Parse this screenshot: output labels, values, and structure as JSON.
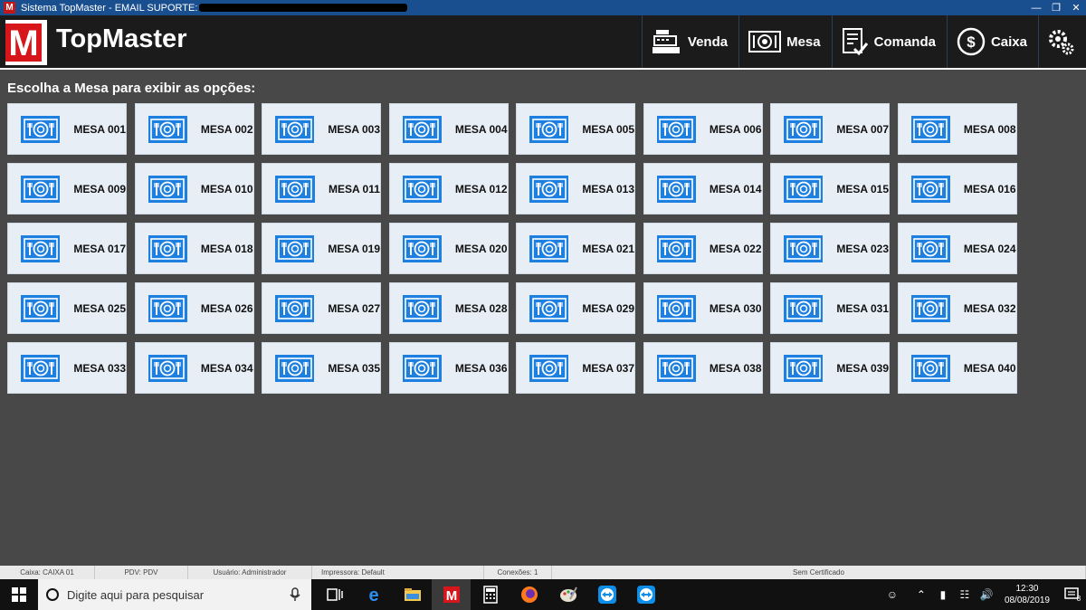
{
  "titlebar": {
    "title": "Sistema TopMaster - EMAIL SUPORTE:"
  },
  "header": {
    "brand": "TopMaster",
    "logo_letter": "M",
    "nav": [
      {
        "label": "Venda",
        "icon": "cash-register-icon"
      },
      {
        "label": "Mesa",
        "icon": "plate-icon"
      },
      {
        "label": "Comanda",
        "icon": "checklist-icon"
      },
      {
        "label": "Caixa",
        "icon": "dollar-coin-icon"
      },
      {
        "label": "",
        "icon": "gears-icon"
      }
    ]
  },
  "main": {
    "prompt": "Escolha a Mesa para exibir as opções:",
    "tables": [
      "MESA 001",
      "MESA 002",
      "MESA 003",
      "MESA 004",
      "MESA 005",
      "MESA 006",
      "MESA 007",
      "MESA 008",
      "MESA 009",
      "MESA 010",
      "MESA 011",
      "MESA 012",
      "MESA 013",
      "MESA 014",
      "MESA 015",
      "MESA 016",
      "MESA 017",
      "MESA 018",
      "MESA 019",
      "MESA 020",
      "MESA 021",
      "MESA 022",
      "MESA 023",
      "MESA 024",
      "MESA 025",
      "MESA 026",
      "MESA 027",
      "MESA 028",
      "MESA 029",
      "MESA 030",
      "MESA 031",
      "MESA 032",
      "MESA 033",
      "MESA 034",
      "MESA 035",
      "MESA 036",
      "MESA 037",
      "MESA 038",
      "MESA 039",
      "MESA 040"
    ]
  },
  "statusbar": {
    "caixa": "Caixa: CAIXA 01",
    "pdv": "PDV: PDV",
    "usuario": "Usuário: Administrador",
    "impressora": "Impressora: Default",
    "conexoes": "Conexões: 1",
    "certificado": "Sem Certificado"
  },
  "taskbar": {
    "search_placeholder": "Digite aqui para pesquisar",
    "time": "12:30",
    "date": "08/08/2019",
    "notification_count": "8"
  },
  "colors": {
    "accent": "#1d7fe0",
    "logo_red": "#d6161a",
    "header_bg": "#1b1b1b",
    "body_bg": "#484848",
    "titlebar_bg": "#1a4f8f"
  }
}
